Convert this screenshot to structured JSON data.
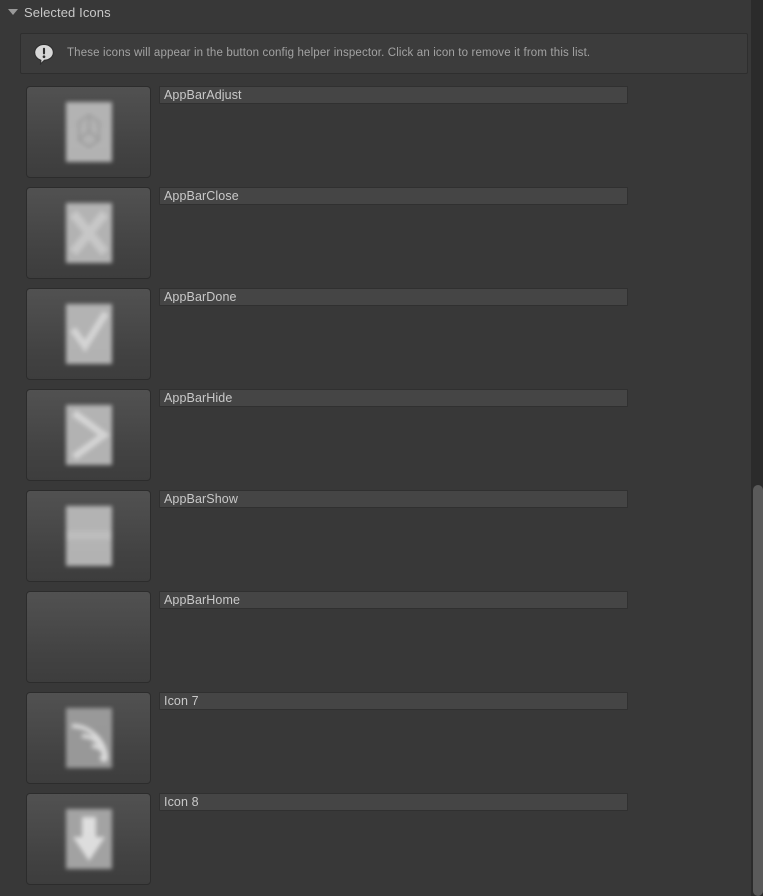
{
  "panel": {
    "foldout_label": "Selected Icons",
    "foldout_expanded": true,
    "foldout_icon": "triangle-down-icon"
  },
  "helpbox": {
    "icon": "info-speech-bubble-icon",
    "message": "These icons will appear in the button config helper inspector. Click an icon to remove it from this list."
  },
  "icons": [
    {
      "name": "AppBarAdjust",
      "sprite": "adjust-glyph",
      "blank": false
    },
    {
      "name": "AppBarClose",
      "sprite": "close-x-glyph",
      "blank": false
    },
    {
      "name": "AppBarDone",
      "sprite": "checkmark-glyph",
      "blank": false
    },
    {
      "name": "AppBarHide",
      "sprite": "hide-bar-glyph",
      "blank": false
    },
    {
      "name": "AppBarShow",
      "sprite": "show-dash-glyph",
      "blank": false
    },
    {
      "name": "AppBarHome",
      "sprite": "blank-glyph",
      "blank": true
    },
    {
      "name": "Icon 7",
      "sprite": "arcs-glyph",
      "blank": false
    },
    {
      "name": "Icon 8",
      "sprite": "down-arrow-glyph",
      "blank": false
    }
  ],
  "scrollbar": {
    "orientation": "vertical",
    "visible": true
  },
  "colors": {
    "panel_background": "#383838",
    "helpbox_background": "#3c3c3c",
    "field_background": "#454545",
    "text_primary": "#c8c8c8",
    "text_secondary": "#a3a3a3",
    "scrollbar_thumb": "#5a5a5a"
  }
}
